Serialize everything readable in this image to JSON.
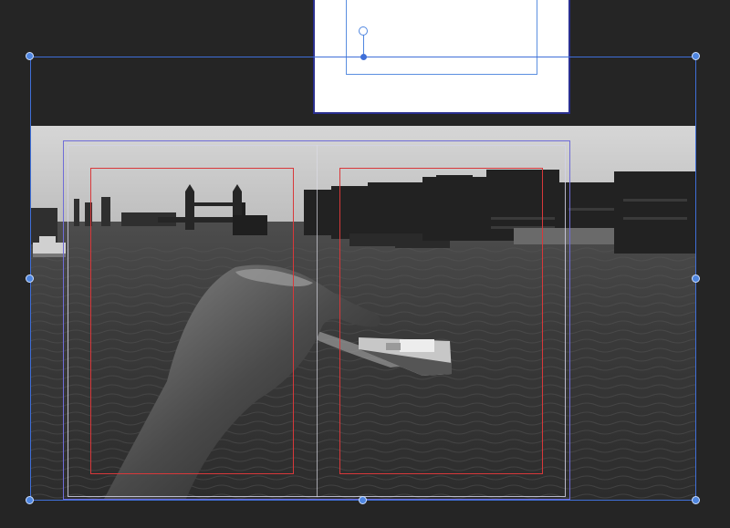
{
  "canvas": {
    "background": "#252525",
    "accent": "#3f6fd8",
    "margin_guide_color": "#d8383a",
    "spread_guide_color": "#6f6cd8"
  },
  "image": {
    "subject": "black-and-white-photo",
    "icons": [
      "rotate-handle-icon",
      "resize-handle-icon",
      "anchor-point-icon"
    ]
  }
}
